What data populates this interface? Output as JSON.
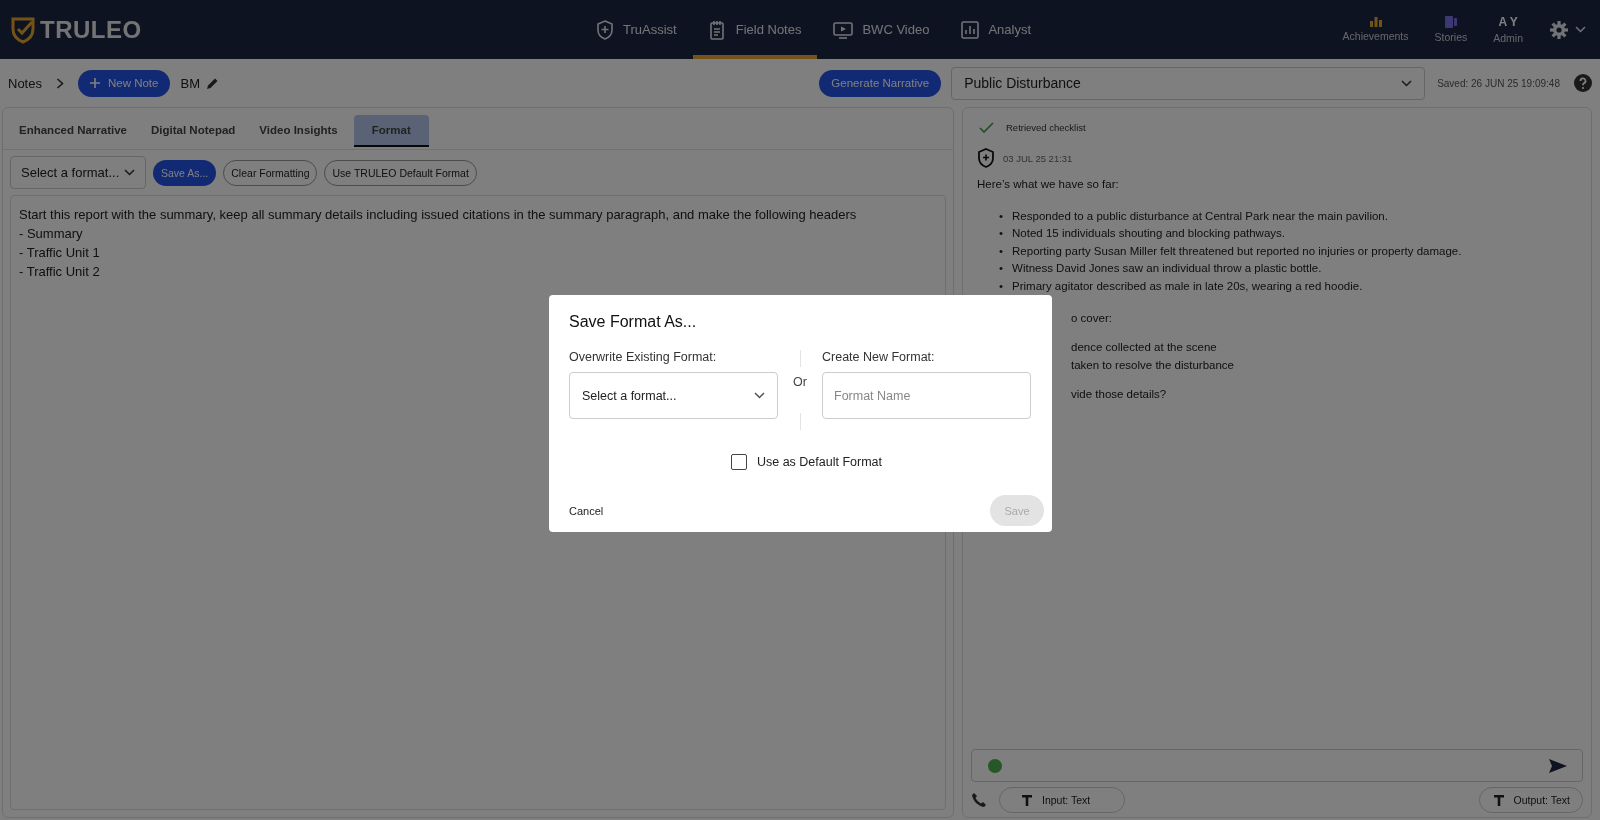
{
  "header": {
    "logo": "TRULEO",
    "nav": [
      {
        "label": "TruAssist",
        "selected": false
      },
      {
        "label": "Field Notes",
        "selected": true
      },
      {
        "label": "BWC Video",
        "selected": false
      },
      {
        "label": "Analyst",
        "selected": false
      }
    ],
    "achievements": "Achievements",
    "stories": "Stories",
    "user": {
      "initials": "A Y",
      "role": "Admin"
    }
  },
  "toolbar": {
    "breadcrumb": "Notes",
    "new_note": "New Note",
    "note_name": "BM",
    "generate": "Generate Narrative",
    "incident_type": "Public Disturbance",
    "saved": "Saved: 26 JUN 25 19:09:48"
  },
  "tabs": [
    {
      "label": "Enhanced Narrative",
      "selected": false
    },
    {
      "label": "Digital Notepad",
      "selected": false
    },
    {
      "label": "Video Insights",
      "selected": false
    },
    {
      "label": "Format",
      "selected": true
    }
  ],
  "format_bar": {
    "select": "Select a format...",
    "save_as": "Save As...",
    "clear": "Clear Formatting",
    "default": "Use TRULEO Default Format"
  },
  "instructions": [
    "Start this report with the summary, keep all summary details including issued citations in the summary paragraph, and make the following headers",
    "- Summary",
    "- Traffic Unit 1",
    "- Traffic Unit 2"
  ],
  "chat": {
    "status": "Retrieved checklist",
    "timestamp": "03 JUL 25 21:31",
    "intro": "Here’s what we have so far:",
    "bullet_marker": "•",
    "bullets": [
      "Responded to a public disturbance at Central Park near the main pavilion.",
      "Noted 15 individuals shouting and blocking pathways.",
      "Reporting party Susan Miller felt threatened but reported no injuries or property damage.",
      "Witness David Jones saw an individual throw a plastic bottle.",
      "Primary agitator described as male in late 20s, wearing a red hoodie."
    ],
    "partial_groups": [
      [
        "o cover:"
      ],
      [
        "dence collected at the scene",
        "taken to resolve the disturbance"
      ],
      [
        "vide those details?"
      ]
    ],
    "input_mode": "Input: Text",
    "output_mode": "Output: Text"
  },
  "dialog": {
    "title": "Save Format As...",
    "overwrite_label": "Overwrite Existing Format:",
    "overwrite_select": "Select a format...",
    "or": "Or",
    "create_label": "Create New Format:",
    "name_placeholder": "Format Name",
    "checkbox": {
      "label": "Use as Default Format",
      "checked": false
    },
    "cancel": "Cancel",
    "save": {
      "label": "Save",
      "disabled": true
    }
  }
}
